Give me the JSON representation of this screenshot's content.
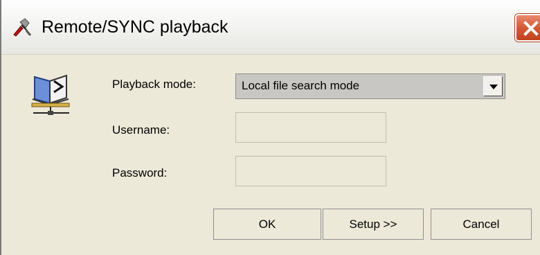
{
  "window": {
    "title": "Remote/SYNC playback"
  },
  "form": {
    "playback_mode": {
      "label": "Playback mode:",
      "value": "Local file search mode"
    },
    "username": {
      "label": "Username:",
      "value": ""
    },
    "password": {
      "label": "Password:",
      "value": ""
    }
  },
  "buttons": {
    "ok": "OK",
    "setup": "Setup >>",
    "cancel": "Cancel"
  },
  "icons": {
    "title": "playback-tools-icon",
    "main": "network-book-icon",
    "close": "close-icon",
    "dropdown": "chevron-down-icon"
  },
  "colors": {
    "close_button": "#d45a36",
    "dialog_background": "#ece9d8",
    "combo_background": "#c9c7c3"
  }
}
